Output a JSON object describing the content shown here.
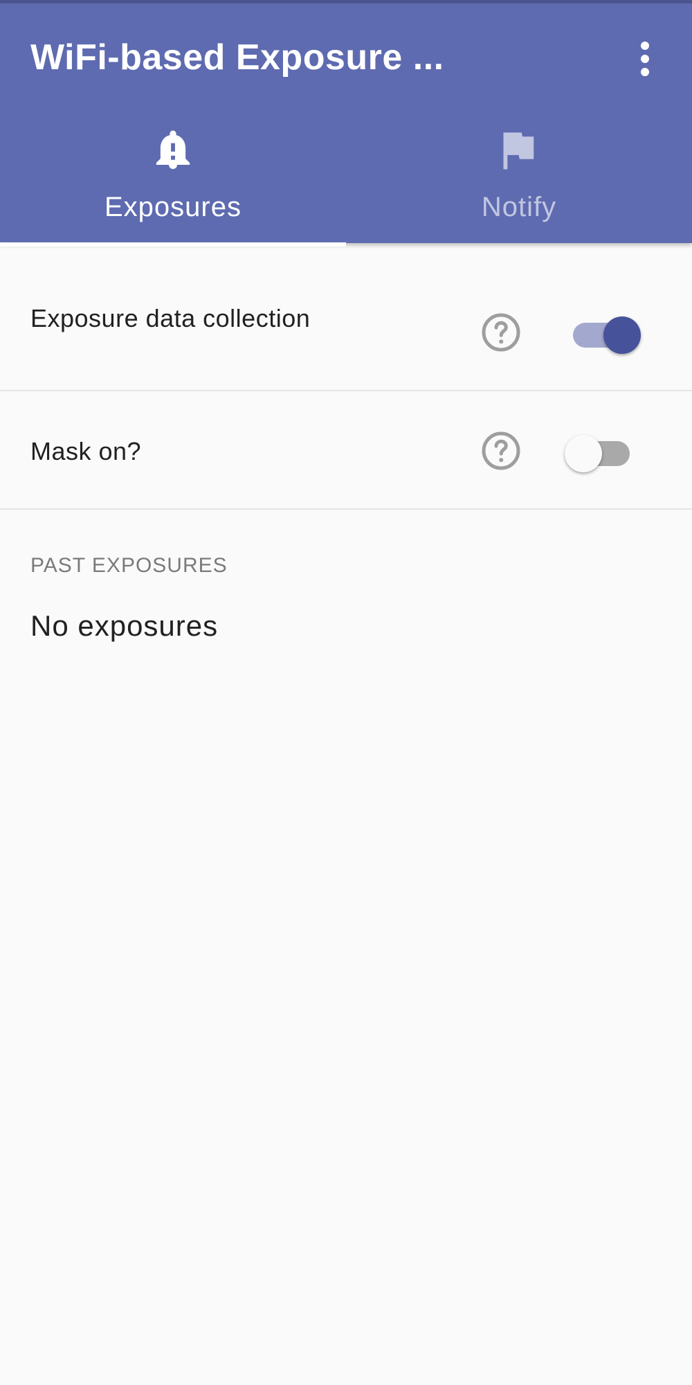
{
  "app_bar": {
    "title": "WiFi-based Exposure ...",
    "background_color": "#5e6bb0",
    "overflow_icon": "more-vert-icon"
  },
  "tabs": [
    {
      "label": "Exposures",
      "icon": "bell-alert-icon",
      "selected": true
    },
    {
      "label": "Notify",
      "icon": "flag-icon",
      "selected": false
    }
  ],
  "settings": {
    "data_collection": {
      "label": "Exposure data collection",
      "help_icon": "help-circle-icon",
      "enabled": true
    },
    "mask_on": {
      "label": "Mask on?",
      "help_icon": "help-circle-icon",
      "enabled": false
    }
  },
  "past_exposures": {
    "header": "PAST EXPOSURES",
    "empty_text": "No exposures"
  },
  "colors": {
    "accent": "#46529a",
    "accent_light": "#a3a8cf"
  }
}
